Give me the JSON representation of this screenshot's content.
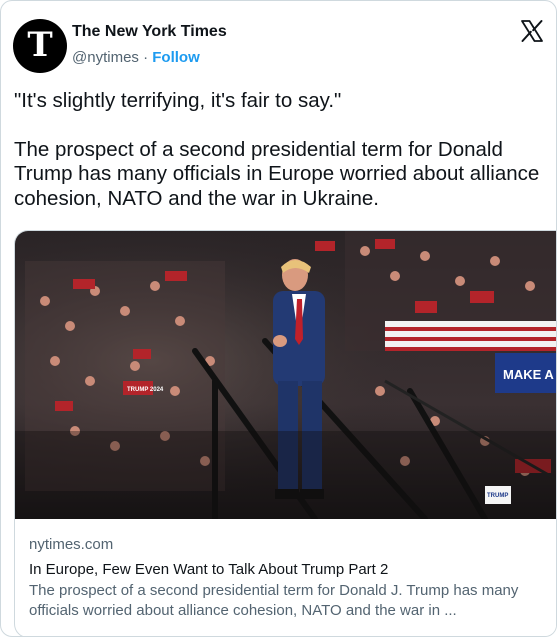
{
  "account": {
    "name": "The New York Times",
    "handle": "@nytimes",
    "separator": "·",
    "follow_label": "Follow",
    "avatar_glyph": "T",
    "platform_icon": "x-logo-icon"
  },
  "tweet": {
    "quote": "\"It's slightly terrifying, it's fair to say.\"",
    "body": "The prospect of a second presidential term for Donald Trump has many officials in Europe worried about alliance cohesion, NATO and the war in Ukraine."
  },
  "link_card": {
    "domain": "nytimes.com",
    "headline": "In Europe, Few Even Want to Talk About Trump Part 2",
    "description": "The prospect of a second presidential term for Donald J. Trump has many officials worried about alliance cohesion, NATO and the war in ...",
    "image": {
      "signs": [
        "TRUMP 2024",
        "MAKE A",
        "TRUMP"
      ]
    }
  },
  "colors": {
    "accent": "#1d9bf0",
    "text": "#0f1419",
    "secondary": "#536471",
    "border": "#cfd9de"
  }
}
